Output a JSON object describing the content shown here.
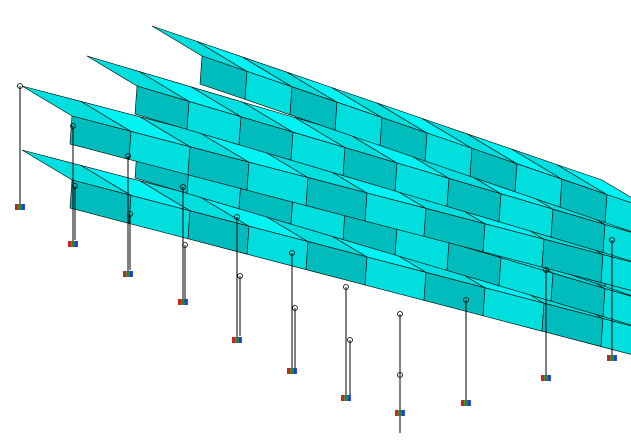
{
  "viewport": {
    "background": "#ffffff",
    "shell_colors": {
      "light": "#00f2f2",
      "mid": "#00dede",
      "dark": "#00bcbc",
      "outline": "#000000"
    },
    "support_colors": [
      "#d21f1f",
      "#1f8a1f",
      "#1f3fd2"
    ]
  },
  "model": {
    "type": "double-layer corrugated roof shell",
    "levels": 2,
    "element": "shell-beam-frame",
    "column_icon": "column-icon",
    "support_icon": "fixed-support-icon"
  }
}
